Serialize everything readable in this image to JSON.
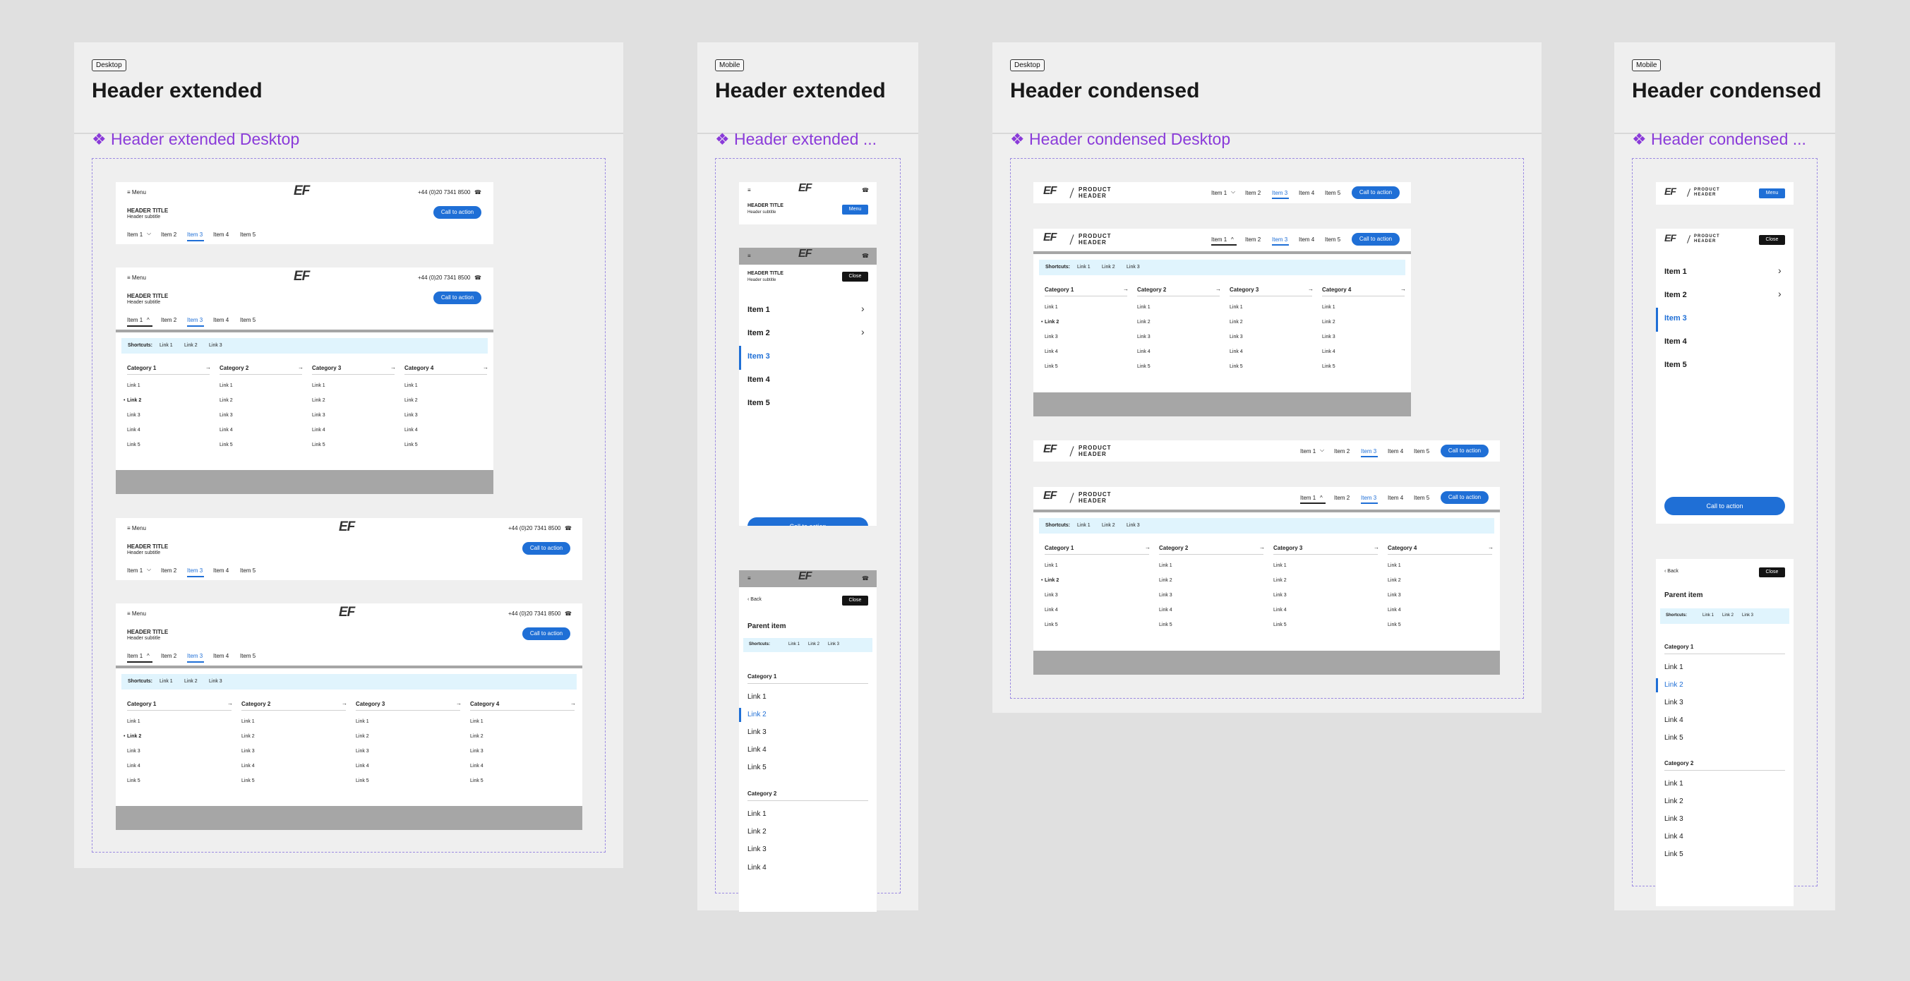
{
  "frames": [
    {
      "badge": "Desktop",
      "title": "Header extended",
      "component": "❖ Header extended Desktop"
    },
    {
      "badge": "Mobile",
      "title": "Header extended",
      "component": "❖ Header extended ..."
    },
    {
      "badge": "Desktop",
      "title": "Header condensed",
      "component": "❖ Header condensed Desktop"
    },
    {
      "badge": "Mobile",
      "title": "Header condensed",
      "component": "❖ Header condensed ..."
    }
  ],
  "header": {
    "menu": "≡ Menu",
    "logo": "EF",
    "phone": "+44 (0)20 7341 8500",
    "phone_icon": "phone-icon",
    "title": "HEADER TITLE",
    "subtitle": "Header subtitle",
    "cta": "Call to action",
    "product_line1": "PRODUCT",
    "product_line2": "HEADER",
    "menu_button": "Menu",
    "close_button": "Close",
    "nav": [
      "Item 1",
      "Item 2",
      "Item 3",
      "Item 4",
      "Item 5"
    ],
    "chev_down": "⌵",
    "chev_up": "^"
  },
  "mega": {
    "shortcuts_label": "Shortcuts:",
    "shortcuts": [
      "Link 1",
      "Link 2",
      "Link 3"
    ],
    "categories": [
      "Category 1",
      "Category 2",
      "Category 3",
      "Category 4"
    ],
    "links": [
      "Link 1",
      "Link 2",
      "Link 3",
      "Link 4",
      "Link 5"
    ],
    "arrow": "→"
  },
  "mobile": {
    "back": "‹  Back",
    "parent": "Parent item",
    "chevron": "›",
    "cat1": "Category 1",
    "cat2": "Category 2",
    "cut_link": "Link 4"
  },
  "colors": {
    "accent": "#1f6fd6",
    "component_label": "#8a3ad9",
    "shortcut_bg": "#e0f4fd",
    "scrim": "#a6a6a6"
  }
}
